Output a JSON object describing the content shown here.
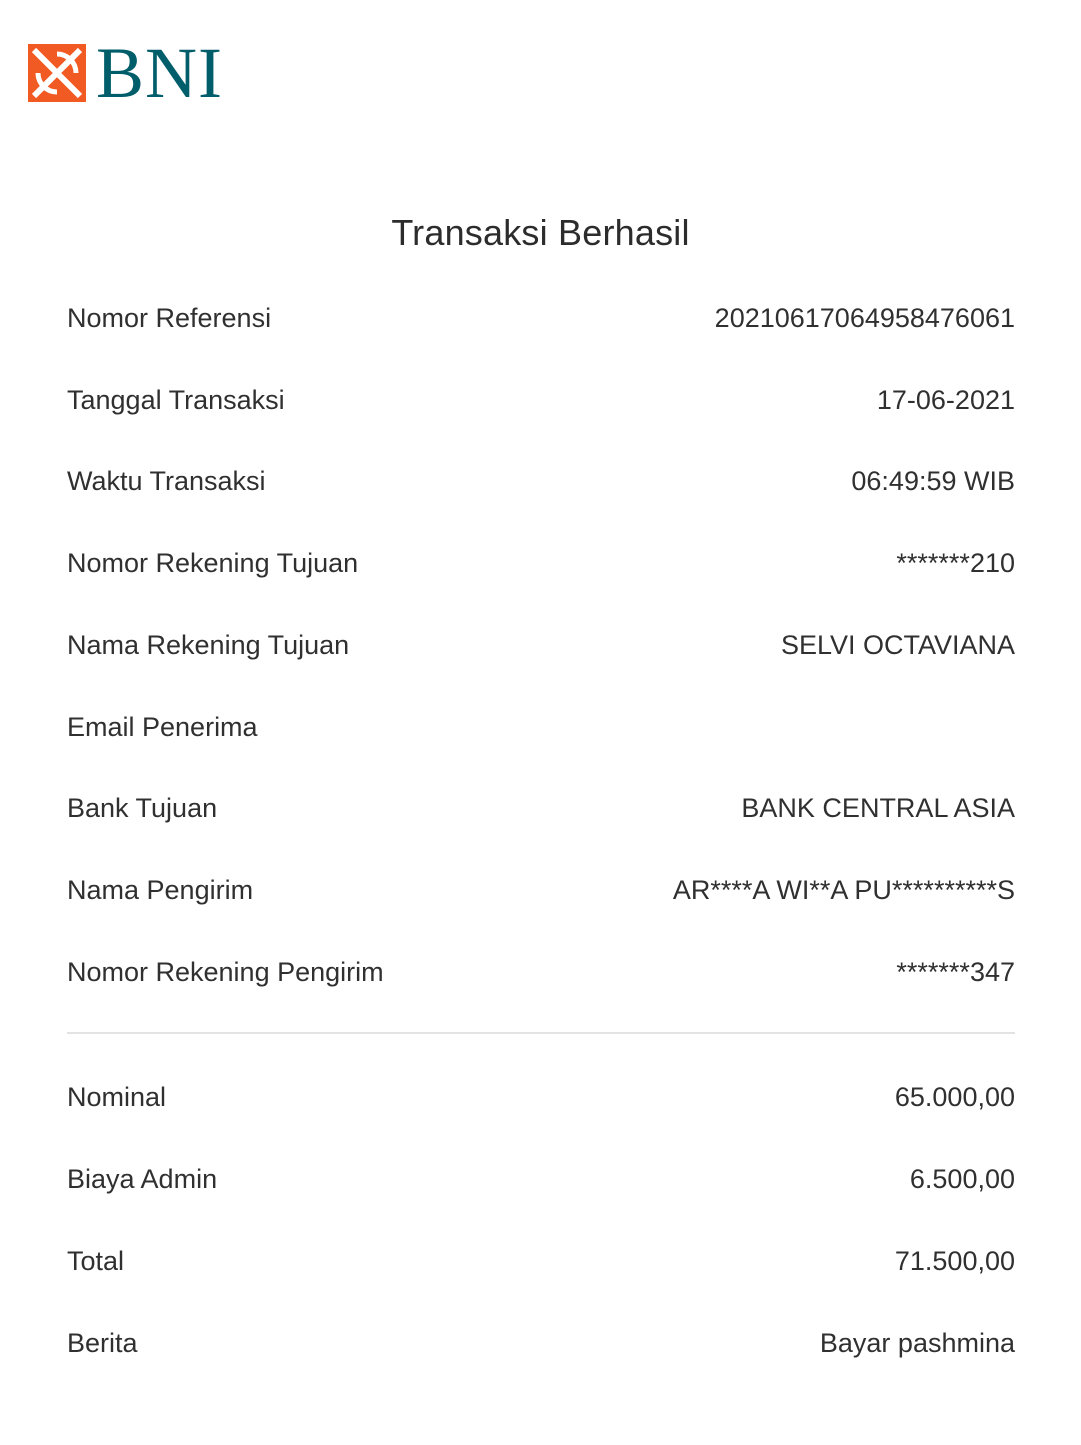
{
  "brand": {
    "name": "BNI",
    "icon": "bni-logo-icon",
    "logo_color": "#005e6a",
    "mark_color": "#f15a22"
  },
  "receipt": {
    "title": "Transaksi Berhasil",
    "details": [
      {
        "label": "Nomor Referensi",
        "value": "20210617064958476061"
      },
      {
        "label": "Tanggal Transaksi",
        "value": "17-06-2021"
      },
      {
        "label": "Waktu Transaksi",
        "value": "06:49:59 WIB"
      },
      {
        "label": "Nomor Rekening Tujuan",
        "value": "*******210"
      },
      {
        "label": "Nama Rekening Tujuan",
        "value": "SELVI OCTAVIANA"
      },
      {
        "label": "Email Penerima",
        "value": ""
      },
      {
        "label": "Bank Tujuan",
        "value": "BANK CENTRAL ASIA"
      },
      {
        "label": "Nama Pengirim",
        "value": "AR****A WI**A PU**********S"
      },
      {
        "label": "Nomor Rekening Pengirim",
        "value": "*******347"
      }
    ],
    "amounts": [
      {
        "label": "Nominal",
        "value": "65.000,00"
      },
      {
        "label": "Biaya Admin",
        "value": "6.500,00"
      },
      {
        "label": "Total",
        "value": "71.500,00"
      },
      {
        "label": "Berita",
        "value": "Bayar pashmina"
      }
    ]
  }
}
